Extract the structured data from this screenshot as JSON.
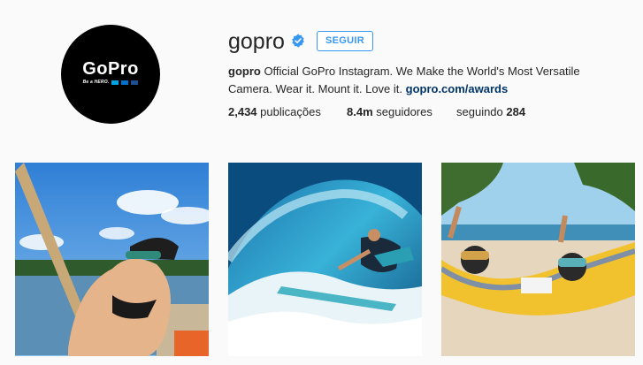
{
  "profile": {
    "username": "gopro",
    "follow_label": "SEGUIR",
    "avatar_logo": "GoPro",
    "avatar_tagline": "Be a HERO.",
    "bio_name": "gopro",
    "bio_text": " Official GoPro Instagram. We Make the World's Most Versatile Camera. Wear it. Mount it. Love it. ",
    "bio_link": "gopro.com/awards"
  },
  "stats": {
    "posts_count": "2,434",
    "posts_label": "publicações",
    "followers_count": "8.4m",
    "followers_label": "seguidores",
    "following_label": "seguindo",
    "following_count": "284"
  },
  "colors": {
    "accent": "#3897f0",
    "link": "#003569",
    "background": "#fafafa",
    "logo_blue_1": "#00a3e0",
    "logo_blue_2": "#0072ce",
    "logo_blue_3": "#1d4f91"
  },
  "grid": {
    "posts": [
      {
        "name": "post-rope-swing-selfie",
        "description_icon": "photo"
      },
      {
        "name": "post-surfer-wave",
        "description_icon": "photo"
      },
      {
        "name": "post-hammock-beach",
        "description_icon": "photo"
      }
    ]
  }
}
